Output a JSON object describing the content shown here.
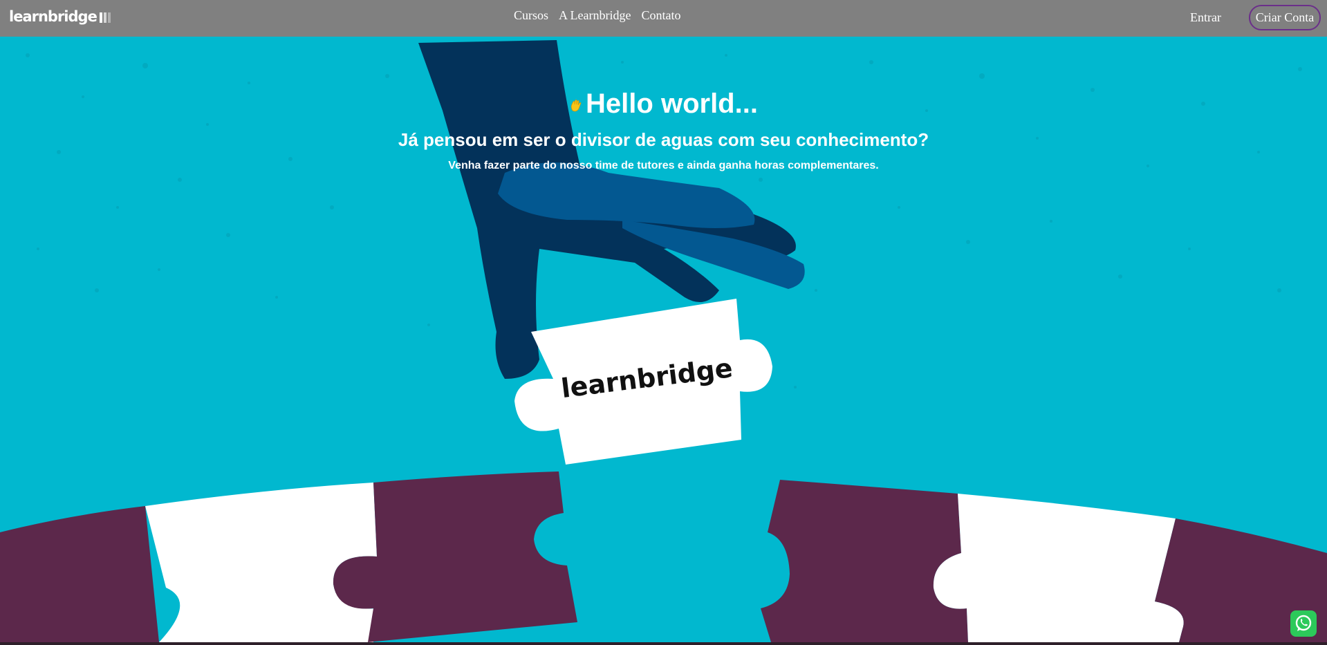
{
  "brand": {
    "name": "learnbridge",
    "bar_colors": [
      "#ffffff",
      "#d6d6d6",
      "#b0b0b0"
    ]
  },
  "nav": {
    "links": [
      {
        "label": "Cursos"
      },
      {
        "label": "A Learnbridge"
      },
      {
        "label": "Contato"
      }
    ],
    "login_label": "Entrar",
    "signup_label": "Criar Conta"
  },
  "hero": {
    "greeting_icon": "waving-hand-icon",
    "greeting": "Hello world...",
    "headline": "Já pensou em ser o divisor de aguas com seu conhecimento?",
    "subheadline": "Venha fazer parte do nosso time de tutores e ainda ganha horas complementares.",
    "puzzle_piece_text": "learnbridge"
  },
  "floating": {
    "whatsapp_icon": "whatsapp-icon"
  },
  "colors": {
    "navbar": "#808080",
    "hero_background": "#01b8cf",
    "hand_dark": "#03325a",
    "hand_light": "#035891",
    "puzzle_purple": "#5c284b",
    "puzzle_white": "#ffffff",
    "signup_border": "#6b2f8a",
    "whatsapp_green": "#2cc95a"
  }
}
